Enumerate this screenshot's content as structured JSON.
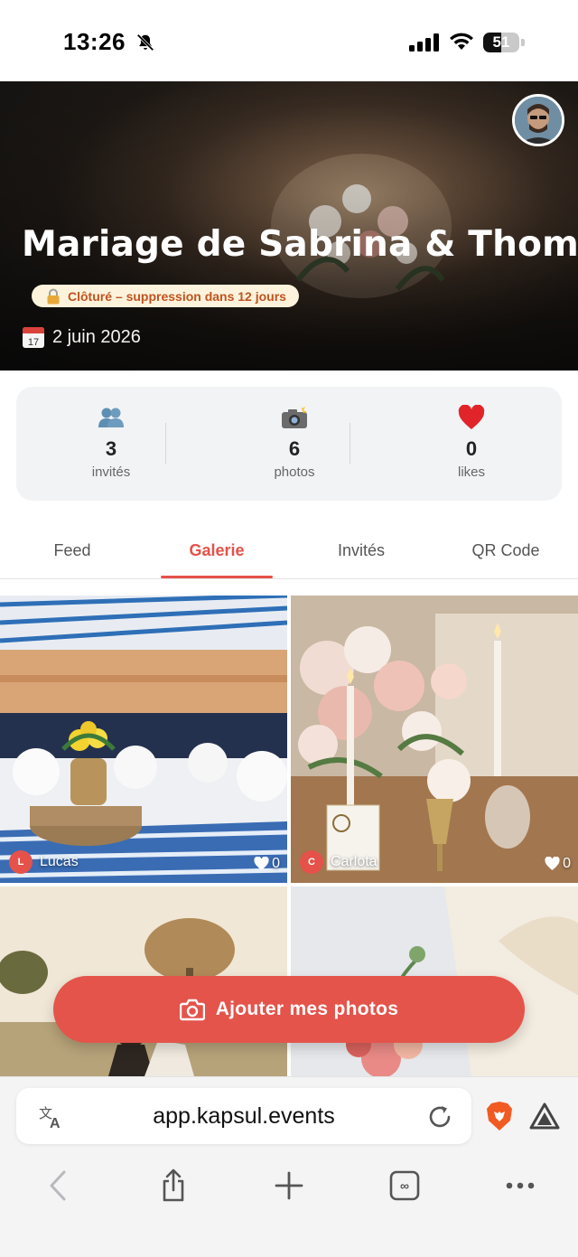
{
  "status_bar": {
    "time": "13:26",
    "battery": "51",
    "battery_level": 0.51,
    "icons": [
      "bell-slash-icon",
      "signal-icon",
      "wifi-icon",
      "battery-icon"
    ]
  },
  "event": {
    "title": "Mariage de Sabrina & Thomas",
    "status": "Clôturé – suppression dans 12 jours",
    "date": "2 juin 2026",
    "date_icon_day": "17"
  },
  "stats": [
    {
      "icon": "people-icon",
      "value": "3",
      "label": "invités"
    },
    {
      "icon": "camera-flash-icon",
      "value": "6",
      "label": "photos"
    },
    {
      "icon": "heart-icon",
      "value": "0",
      "label": "likes"
    }
  ],
  "tabs": [
    {
      "label": "Feed",
      "active": false
    },
    {
      "label": "Galerie",
      "active": true
    },
    {
      "label": "Invités",
      "active": false
    },
    {
      "label": "QR Code",
      "active": false
    }
  ],
  "gallery": [
    {
      "author": "Lucas",
      "initial": "L",
      "likes": "0"
    },
    {
      "author": "Carlota",
      "initial": "C",
      "likes": "0"
    },
    {
      "author": "",
      "initial": "",
      "likes": ""
    },
    {
      "author": "",
      "initial": "",
      "likes": ""
    }
  ],
  "actions": {
    "add_photos": "Ajouter mes photos"
  },
  "browser": {
    "url": "app.kapsul.events",
    "nav_icons": [
      "back-icon",
      "share-icon",
      "new-tab-icon",
      "tabs-icon",
      "more-icon"
    ]
  },
  "colors": {
    "accent": "#e4524a",
    "status_pill_bg": "#fdf3dc",
    "status_pill_text": "#c0531f",
    "stats_bg": "#f1f3f5"
  }
}
